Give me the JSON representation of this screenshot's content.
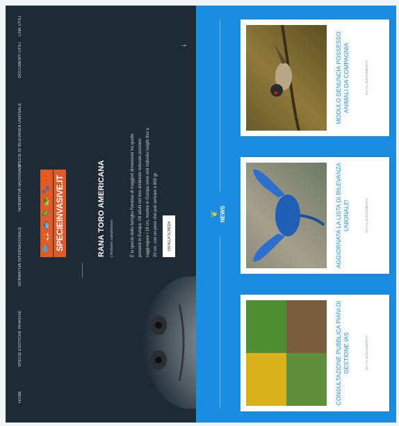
{
  "nav": {
    "items": [
      {
        "label": "HOME"
      },
      {
        "label": "SPECIE ESOTICHE INVASIVE"
      },
      {
        "label": "NORMATIVA INTERNAZIONALE"
      },
      {
        "label": "NORMATIVA NAZIONALE"
      },
      {
        "label": "SPECIE DI RILEVANZA UNIONALE"
      },
      {
        "label": "DOCUMENTI UTILI"
      },
      {
        "label": "LINK UTILI"
      }
    ]
  },
  "logo": {
    "text": "SPECIEINVASIVE.IT",
    "icons": [
      "🐦",
      "🦊",
      "🐟",
      "🦎",
      "🐢",
      "🐾",
      "🦀"
    ]
  },
  "hero": {
    "title": "RANA TORO AMERICANA",
    "subtitle": "Lithobates catesbeianus",
    "body": "È la specie della famiglia Ranidae di maggiori dimensioni tra quelle presenti in Europa. Gli adulti nel loro ambiente naturale possono raggiungere i 18 cm, mentre in Europa sono noti individui lunghi fino a 20 cm, con un peso che può arrivare a 800 gr.",
    "button": "VAI ALLA SCHEDA",
    "scroll_icon": "arrow-down-icon"
  },
  "news": {
    "title": "NEWS",
    "icon": "sprout-icon",
    "cards": [
      {
        "title": "CONSULTAZIONE PUBBLICA PIANI DI GESTIONE IAS",
        "link": "VAI AL DOCUMENTO",
        "image": "plants-collage"
      },
      {
        "title": "AGGIORNATA LA LISTA DI RILEVANZA UNIONALE!",
        "link": "VAI AL DOCUMENTO",
        "image": "blue-crayfish"
      },
      {
        "title": "MODULO DENUNCIA POSSESSO ANIMALI DA COMPAGNIA",
        "link": "VAI AL DOCUMENTO",
        "image": "bird-on-branch"
      }
    ]
  },
  "colors": {
    "dark": "#1e2b35",
    "blue": "#1a8de0",
    "orange": "#e05b2a",
    "yellow": "#ffd21a"
  }
}
